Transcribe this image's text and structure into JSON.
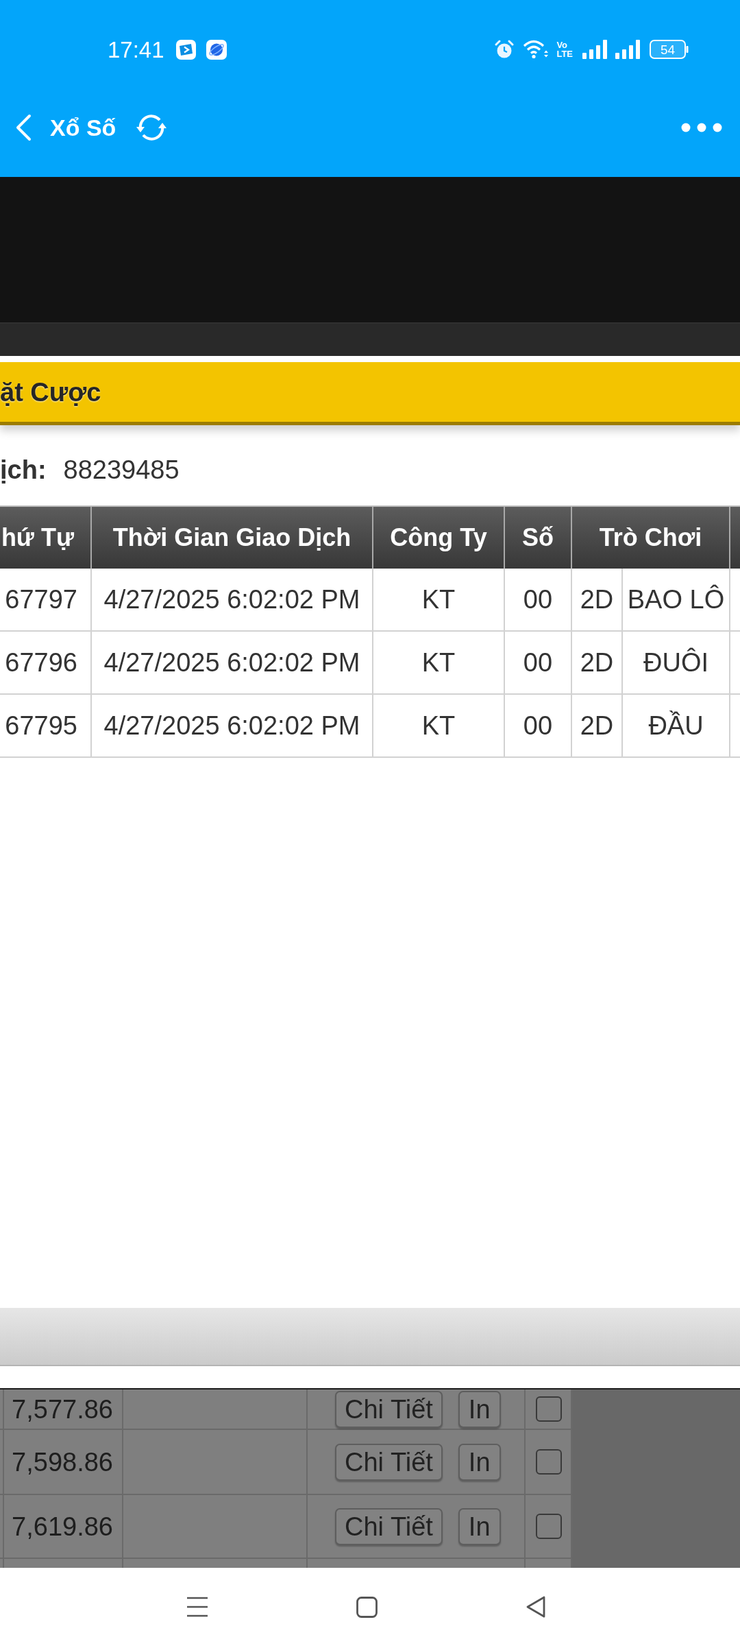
{
  "status_bar": {
    "time": "17:41",
    "volte_top": "Vo",
    "volte_bottom": "LTE",
    "battery": "54"
  },
  "app_bar": {
    "title": "Xổ Số"
  },
  "dialog": {
    "title": "ặt Cược",
    "transaction_label": "ịch:",
    "transaction_id": "88239485",
    "table": {
      "columns": [
        "hứ Tự",
        "Thời Gian Giao Dịch",
        "Công Ty",
        "Số",
        "Trò Chơi"
      ],
      "rows": [
        {
          "cells": [
            "67797",
            "4/27/2025 6:02:02 PM",
            "KT",
            "00",
            "2D",
            "BAO LÔ"
          ]
        },
        {
          "cells": [
            "67796",
            "4/27/2025 6:02:02 PM",
            "KT",
            "00",
            "2D",
            "ĐUÔI"
          ]
        },
        {
          "cells": [
            "67795",
            "4/27/2025 6:02:02 PM",
            "KT",
            "00",
            "2D",
            "ĐẦU"
          ]
        }
      ]
    }
  },
  "background_table": {
    "rows": [
      {
        "amount": "7,577.86",
        "detail_button": "Chi Tiết",
        "print_button": "In",
        "checked": false
      },
      {
        "amount": "7,598.86",
        "detail_button": "Chi Tiết",
        "print_button": "In",
        "checked": false
      },
      {
        "amount": "7,619.86",
        "detail_button": "Chi Tiết",
        "print_button": "In",
        "checked": false
      }
    ]
  }
}
